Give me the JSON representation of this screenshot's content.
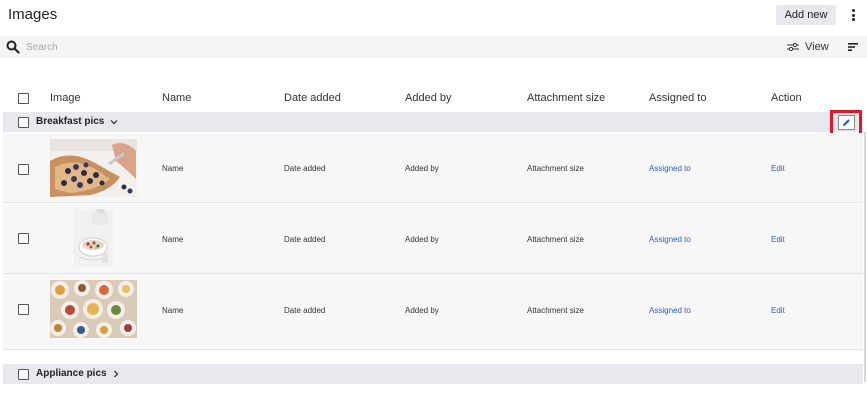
{
  "header": {
    "title": "Images",
    "add_new_label": "Add new"
  },
  "search": {
    "placeholder": "Search",
    "view_label": "View"
  },
  "columns": [
    "Image",
    "Name",
    "Date added",
    "Added by",
    "Attachment size",
    "Assigned to",
    "Action"
  ],
  "groups": [
    {
      "label": "Breakfast pics",
      "expanded": true,
      "rows": [
        {
          "image": "blueberry-toast-photo",
          "name": "Name",
          "date_added": "Date added",
          "added_by": "Added by",
          "attachment_size": "Attachment size",
          "assigned_to": "Assigned to",
          "action": "Edit"
        },
        {
          "image": "granola-bowl-photo",
          "name": "Name",
          "date_added": "Date added",
          "added_by": "Added by",
          "attachment_size": "Attachment size",
          "assigned_to": "Assigned to",
          "action": "Edit"
        },
        {
          "image": "brunch-spread-photo",
          "name": "Name",
          "date_added": "Date added",
          "added_by": "Added by",
          "attachment_size": "Attachment size",
          "assigned_to": "Assigned to",
          "action": "Edit"
        }
      ]
    },
    {
      "label": "Appliance pics",
      "expanded": false,
      "rows": []
    }
  ],
  "colors": {
    "accent_link": "#2a5bd7",
    "highlight": "#e0182a",
    "group_bg": "#e8e9ee"
  },
  "icons": {
    "search": "search-icon",
    "view": "sliders-icon",
    "sort": "sort-lines-icon",
    "more": "kebab-icon",
    "edit": "pencil-icon",
    "expanded": "chevron-down-icon",
    "collapsed": "chevron-right-icon"
  }
}
